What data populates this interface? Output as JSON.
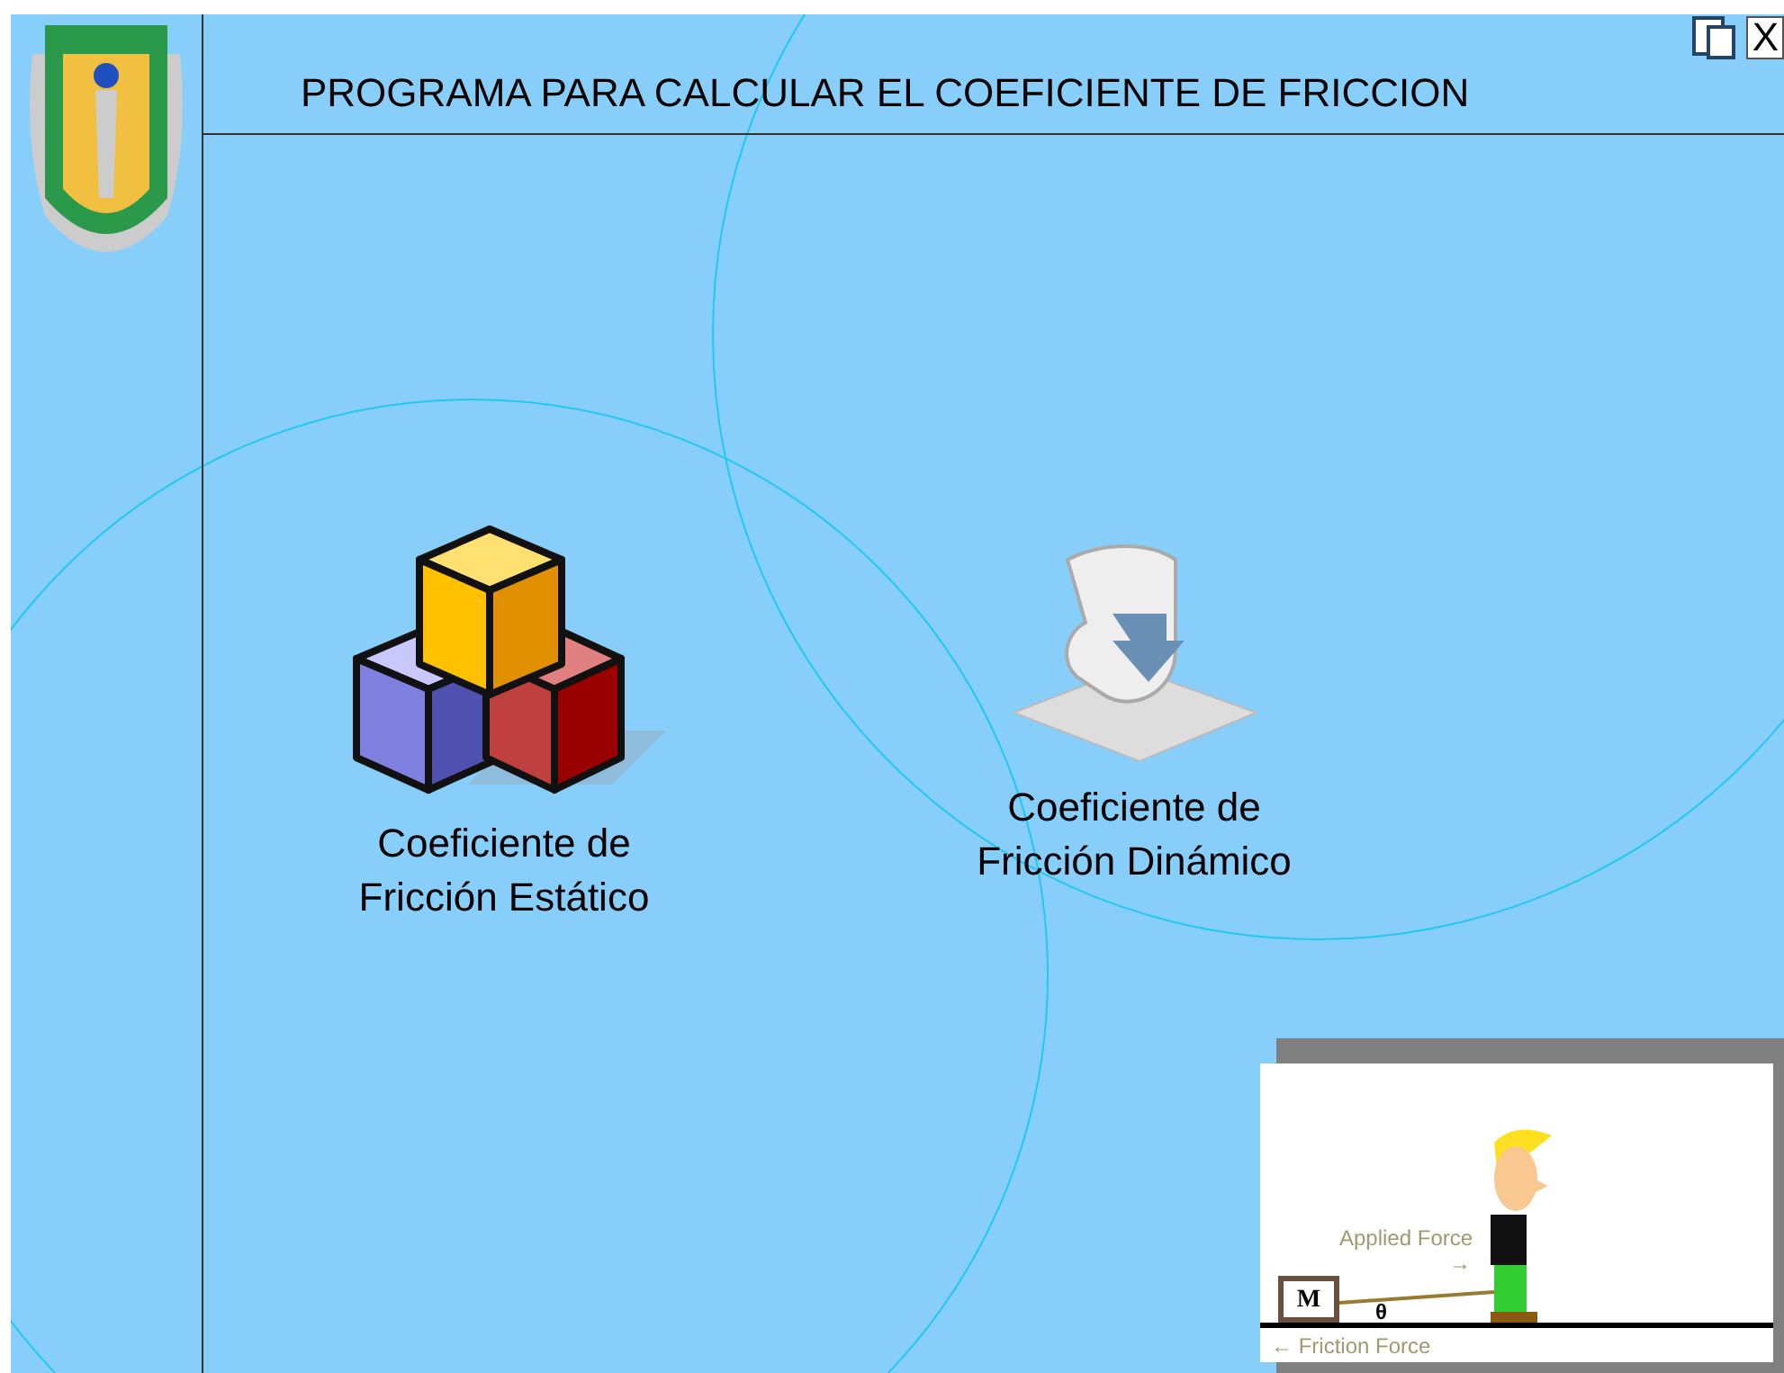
{
  "window": {
    "title": "PROGRAMA PARA CALCULAR EL COEFICIENTE DE FRICCION",
    "close": "X"
  },
  "options": [
    {
      "kind": "blocks",
      "lines": [
        "Coeficiente de",
        "Fricción Estático"
      ]
    },
    {
      "kind": "scroll",
      "lines": [
        "Coeficiente de",
        "Fricción Dinámico"
      ]
    }
  ],
  "illustration": {
    "mass": "M",
    "angle": "θ",
    "applied_force": "Applied Force",
    "applied_arrow": "→",
    "friction_force": "← Friction Force"
  }
}
